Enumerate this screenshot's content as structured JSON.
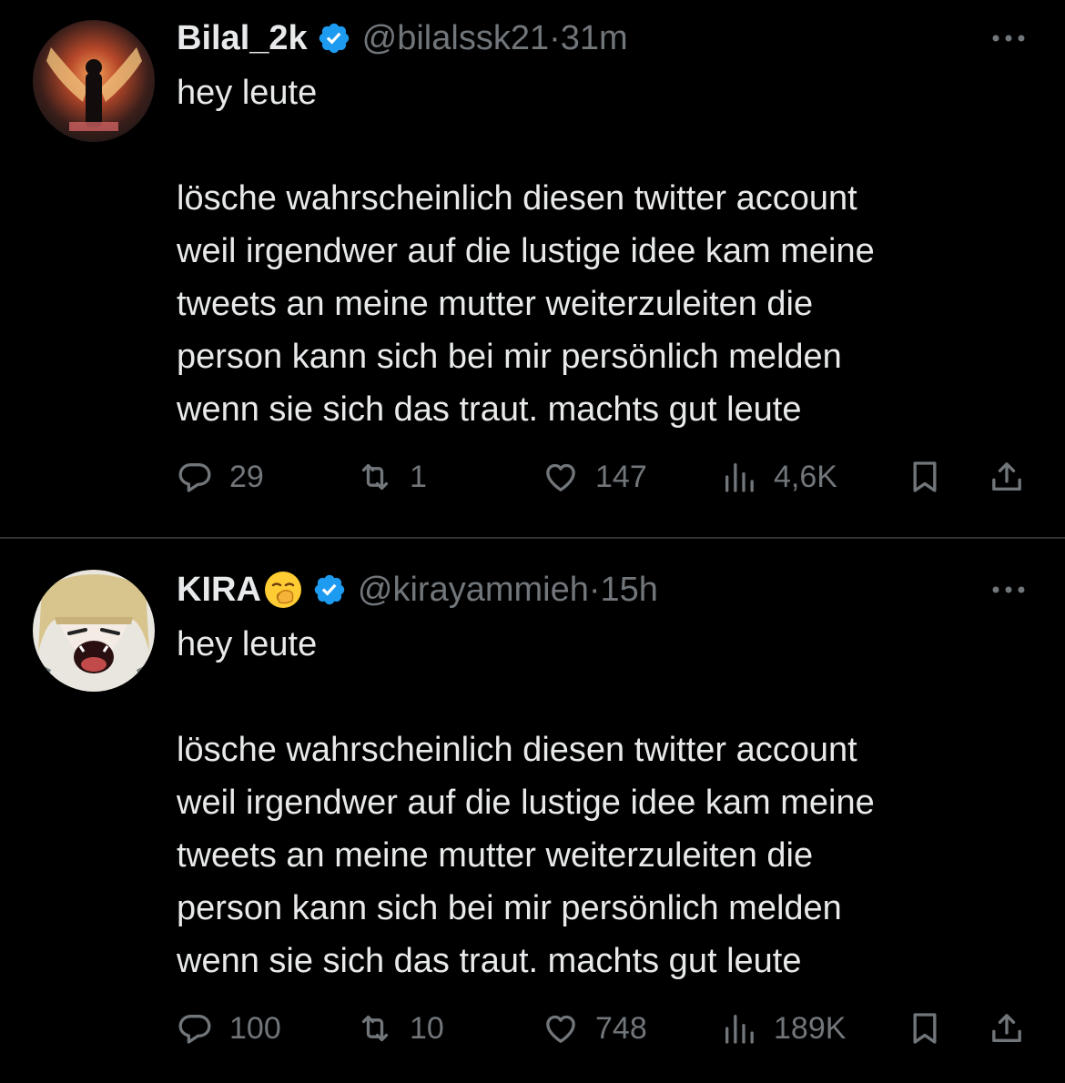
{
  "tweets": [
    {
      "name": "Bilal_2k",
      "handle": "@bilalssk21",
      "dot": "·",
      "time": "31m",
      "line1": "hey leute",
      "body": [
        "lösche wahrscheinlich diesen twitter account",
        "weil irgendwer auf die lustige idee kam meine",
        "tweets an meine mutter weiterzuleiten die",
        "person kann sich bei mir persönlich melden",
        "wenn sie sich das traut. machts gut leute"
      ],
      "replies": "29",
      "retweets": "1",
      "likes": "147",
      "views": "4,6K"
    },
    {
      "name": "KIRA",
      "handle": "@kirayammieh",
      "dot": "·",
      "time": "15h",
      "line1": "hey leute",
      "body": [
        "lösche wahrscheinlich diesen twitter account",
        "weil irgendwer auf die lustige idee kam meine",
        "tweets an meine mutter weiterzuleiten die",
        "person kann sich bei mir persönlich melden",
        "wenn sie sich das traut. machts gut leute"
      ],
      "replies": "100",
      "retweets": "10",
      "likes": "748",
      "views": "189K"
    }
  ],
  "colors": {
    "background": "#000000",
    "text": "#e7e9ea",
    "muted": "#71767b",
    "verified": "#1d9bf0",
    "divider": "#2f3336"
  },
  "icons": [
    "verified-badge-icon",
    "more-icon",
    "reply-icon",
    "retweet-icon",
    "like-icon",
    "views-icon",
    "bookmark-icon",
    "share-icon",
    "yawning-face-emoji"
  ]
}
